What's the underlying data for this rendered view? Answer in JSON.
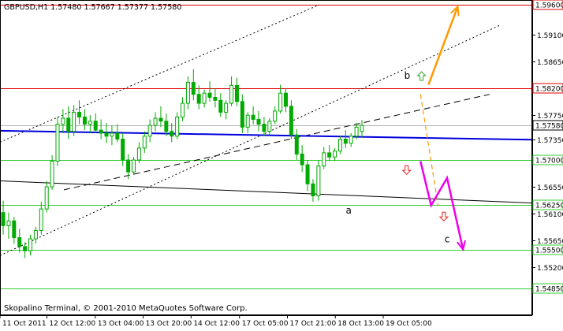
{
  "chart_data": {
    "type": "candlestick",
    "symbol_header": "GBPUSD,H1  1.57480 1.57667 1.57377 1.57580",
    "footer_text": "Skopalino Terminal, © 2001-2010 MetaQuotes Software Corp.",
    "ylim": [
      1.544,
      1.5968
    ],
    "xlim": [
      0,
      100
    ],
    "colors": {
      "background": "#ffffff",
      "candle": "#00aa00",
      "axis": "#000000",
      "level_red": "#e00000",
      "level_green": "#33cc33",
      "trend_blue": "#0000dd",
      "orange_arrow": "#ff9900",
      "magenta_arrow": "#ee00ee"
    },
    "price_ticks": [
      {
        "price": 1.591,
        "label": "1.59100"
      },
      {
        "price": 1.5865,
        "label": "1.58650"
      },
      {
        "price": 1.5775,
        "label": "1.57750"
      },
      {
        "price": 1.5735,
        "label": "1.57350"
      },
      {
        "price": 1.5655,
        "label": "1.56550"
      },
      {
        "price": 1.561,
        "label": "1.56100"
      },
      {
        "price": 1.5565,
        "label": "1.55650"
      },
      {
        "price": 1.552,
        "label": "1.55200"
      }
    ],
    "levels": [
      {
        "price": 1.596,
        "label": "1.59600",
        "color": "#e00000"
      },
      {
        "price": 1.582,
        "label": "1.58200",
        "color": "#e00000"
      },
      {
        "price": 1.57,
        "label": "1.57000",
        "color": "#33cc33"
      },
      {
        "price": 1.5625,
        "label": "1.56250",
        "color": "#33cc33"
      },
      {
        "price": 1.555,
        "label": "1.55500",
        "color": "#33cc33"
      },
      {
        "price": 1.5485,
        "label": "1.54850",
        "color": "#33cc33"
      }
    ],
    "current_price": {
      "price": 1.5758,
      "label": "1.57580"
    },
    "time_labels": [
      {
        "x": 0,
        "label": "11 Oct 2011"
      },
      {
        "x": 8.8,
        "label": "12 Oct 12:00"
      },
      {
        "x": 17.9,
        "label": "13 Oct 04:00"
      },
      {
        "x": 26.9,
        "label": "13 Oct 20:00"
      },
      {
        "x": 35.9,
        "label": "14 Oct 12:00"
      },
      {
        "x": 45.0,
        "label": "17 Oct 05:00"
      },
      {
        "x": 54.0,
        "label": "17 Oct 21:00"
      },
      {
        "x": 63.0,
        "label": "18 Oct 13:00"
      },
      {
        "x": 72.0,
        "label": "19 Oct 05:00"
      }
    ],
    "trendlines": [
      {
        "style": "dotted",
        "color": "#000000",
        "from": [
          0,
          1.554
        ],
        "to": [
          94,
          1.5926
        ]
      },
      {
        "style": "dotted",
        "color": "#000000",
        "from": [
          0,
          1.573
        ],
        "to": [
          60,
          1.596
        ]
      },
      {
        "style": "dashed",
        "color": "#000000",
        "from": [
          12,
          1.565
        ],
        "to": [
          92,
          1.581
        ]
      },
      {
        "style": "solid",
        "color": "#000000",
        "from": [
          0,
          1.5665
        ],
        "to": [
          100,
          1.5628
        ]
      },
      {
        "style": "solid",
        "color": "#0000dd",
        "from": [
          0,
          1.5749
        ],
        "to": [
          100,
          1.5734
        ]
      }
    ],
    "wave_labels": [
      {
        "text": "a",
        "x": 65.5,
        "price": 1.561
      },
      {
        "text": "b",
        "x": 76.5,
        "price": 1.5836
      },
      {
        "text": "c",
        "x": 84.0,
        "price": 1.5562
      }
    ],
    "projections": [
      {
        "name": "orange-solid",
        "color": "#ff9900",
        "style": "solid",
        "points": [
          [
            80.5,
            1.5826
          ],
          [
            86.0,
            1.5957
          ]
        ]
      },
      {
        "name": "orange-dashed",
        "color": "#ff9900",
        "style": "dashed",
        "points": [
          [
            79.0,
            1.581
          ],
          [
            82.3,
            1.5624
          ]
        ]
      },
      {
        "name": "magenta",
        "color": "#ee00ee",
        "style": "solid",
        "points": [
          [
            79.0,
            1.5698
          ],
          [
            81.0,
            1.5624
          ],
          [
            84.0,
            1.567
          ],
          [
            87.0,
            1.555
          ]
        ]
      }
    ],
    "small_arrows": [
      {
        "dir": "up",
        "color": "#33aa33",
        "x": 79.2,
        "price": 1.584
      },
      {
        "dir": "down",
        "color": "#ee2222",
        "x": 76.4,
        "price": 1.5684
      },
      {
        "dir": "down",
        "color": "#ee2222",
        "x": 83.4,
        "price": 1.5606
      }
    ],
    "ohlc": [
      [
        1.5612,
        1.5632,
        1.5575,
        1.559
      ],
      [
        1.559,
        1.5612,
        1.5568,
        1.5598
      ],
      [
        1.5598,
        1.5605,
        1.556,
        1.557
      ],
      [
        1.557,
        1.5585,
        1.5545,
        1.5555
      ],
      [
        1.5555,
        1.5562,
        1.5536,
        1.5548
      ],
      [
        1.5548,
        1.5575,
        1.554,
        1.5568
      ],
      [
        1.5568,
        1.5588,
        1.556,
        1.5582
      ],
      [
        1.5582,
        1.563,
        1.5575,
        1.5618
      ],
      [
        1.5618,
        1.5665,
        1.5612,
        1.5655
      ],
      [
        1.5655,
        1.5708,
        1.565,
        1.5698
      ],
      [
        1.5698,
        1.5772,
        1.569,
        1.576
      ],
      [
        1.576,
        1.5785,
        1.5745,
        1.577
      ],
      [
        1.577,
        1.579,
        1.5735,
        1.5748
      ],
      [
        1.5748,
        1.5792,
        1.574,
        1.578
      ],
      [
        1.578,
        1.58,
        1.576,
        1.5772
      ],
      [
        1.5772,
        1.5785,
        1.575,
        1.576
      ],
      [
        1.576,
        1.5775,
        1.5745,
        1.5765
      ],
      [
        1.5765,
        1.5778,
        1.5745,
        1.575
      ],
      [
        1.575,
        1.5768,
        1.5735,
        1.5745
      ],
      [
        1.5745,
        1.5762,
        1.5728,
        1.574
      ],
      [
        1.574,
        1.5758,
        1.5725,
        1.5745
      ],
      [
        1.5745,
        1.576,
        1.573,
        1.5735
      ],
      [
        1.5735,
        1.5745,
        1.569,
        1.57
      ],
      [
        1.57,
        1.571,
        1.5668,
        1.568
      ],
      [
        1.568,
        1.5705,
        1.5675,
        1.57
      ],
      [
        1.57,
        1.573,
        1.5695,
        1.572
      ],
      [
        1.572,
        1.5748,
        1.5712,
        1.574
      ],
      [
        1.574,
        1.5768,
        1.573,
        1.5758
      ],
      [
        1.5758,
        1.578,
        1.5748,
        1.577
      ],
      [
        1.577,
        1.579,
        1.5755,
        1.5765
      ],
      [
        1.5765,
        1.5778,
        1.574,
        1.5748
      ],
      [
        1.5748,
        1.5762,
        1.573,
        1.574
      ],
      [
        1.574,
        1.578,
        1.5735,
        1.5772
      ],
      [
        1.5772,
        1.5805,
        1.5765,
        1.5795
      ],
      [
        1.5795,
        1.584,
        1.5785,
        1.583
      ],
      [
        1.583,
        1.5852,
        1.58,
        1.581
      ],
      [
        1.581,
        1.5825,
        1.5785,
        1.5795
      ],
      [
        1.5795,
        1.5818,
        1.5788,
        1.5812
      ],
      [
        1.5812,
        1.5832,
        1.5798,
        1.5805
      ],
      [
        1.5805,
        1.582,
        1.5788,
        1.58
      ],
      [
        1.58,
        1.5812,
        1.5772,
        1.578
      ],
      [
        1.578,
        1.58,
        1.5768,
        1.5795
      ],
      [
        1.5795,
        1.584,
        1.579,
        1.5825
      ],
      [
        1.5825,
        1.5838,
        1.579,
        1.5798
      ],
      [
        1.5798,
        1.581,
        1.5745,
        1.5755
      ],
      [
        1.5755,
        1.578,
        1.5745,
        1.5775
      ],
      [
        1.5775,
        1.579,
        1.576,
        1.5768
      ],
      [
        1.5768,
        1.5782,
        1.5748,
        1.576
      ],
      [
        1.576,
        1.5772,
        1.574,
        1.5748
      ],
      [
        1.5748,
        1.577,
        1.5742,
        1.5765
      ],
      [
        1.5765,
        1.579,
        1.576,
        1.5782
      ],
      [
        1.5782,
        1.5826,
        1.5778,
        1.5812
      ],
      [
        1.5812,
        1.582,
        1.578,
        1.579
      ],
      [
        1.579,
        1.58,
        1.5735,
        1.5742
      ],
      [
        1.5742,
        1.5752,
        1.57,
        1.571
      ],
      [
        1.571,
        1.5725,
        1.568,
        1.5692
      ],
      [
        1.5692,
        1.57,
        1.5648,
        1.566
      ],
      [
        1.566,
        1.5668,
        1.563,
        1.564
      ],
      [
        1.564,
        1.57,
        1.5632,
        1.569
      ],
      [
        1.569,
        1.5722,
        1.5685,
        1.5712
      ],
      [
        1.5712,
        1.5725,
        1.5698,
        1.5705
      ],
      [
        1.5705,
        1.572,
        1.5698,
        1.5715
      ],
      [
        1.5715,
        1.574,
        1.571,
        1.5735
      ],
      [
        1.5735,
        1.575,
        1.572,
        1.5728
      ],
      [
        1.5728,
        1.5745,
        1.5722,
        1.574
      ],
      [
        1.574,
        1.5762,
        1.5735,
        1.5755
      ],
      [
        1.5748,
        1.5767,
        1.5738,
        1.5758
      ]
    ]
  }
}
